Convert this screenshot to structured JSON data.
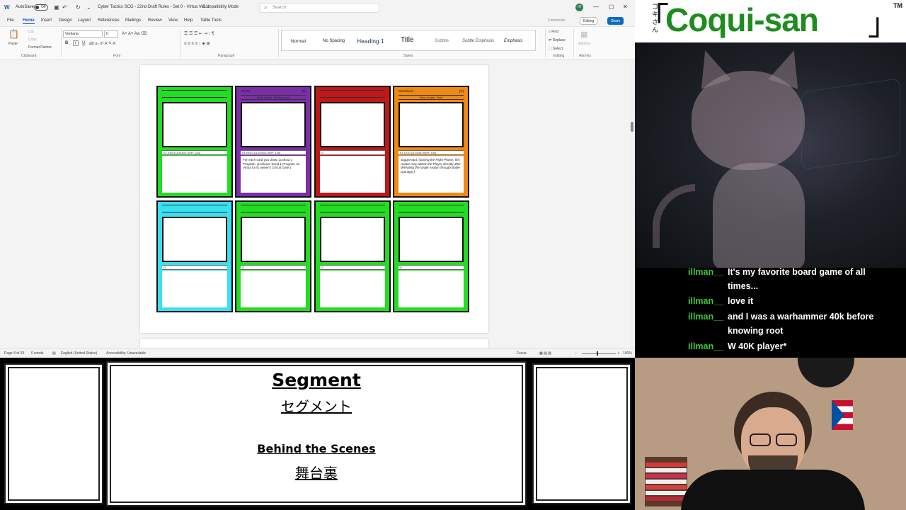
{
  "word": {
    "autosave_label": "AutoSave",
    "autosave_state": "Off",
    "doc_title": "Cyber Tactics SCG - 22nd Draft Rules - Set 0 - Virtua Vol. 1",
    "compat": "Compatibility Mode",
    "search_placeholder": "Search",
    "user_initials": "HI",
    "menus": [
      "File",
      "Home",
      "Insert",
      "Design",
      "Layout",
      "References",
      "Mailings",
      "Review",
      "View",
      "Help",
      "Table Tools"
    ],
    "comments_label": "Comments",
    "editing_label": "Editing",
    "share_label": "Share",
    "ribbon": {
      "paste": "Paste",
      "cut": "Cut",
      "copy": "Copy",
      "format_painter": "Format Painter",
      "font_name": "Verdana",
      "font_size": "6",
      "styles": [
        "Normal",
        "No Spacing",
        "Heading 1",
        "Title",
        "Subtitle",
        "Subtle Emphasis",
        "Emphasis"
      ],
      "find": "Find",
      "replace": "Replace",
      "select": "Select",
      "addin": "Add-ins",
      "groups": [
        "Clipboard",
        "Font",
        "Paragraph",
        "Styles",
        "Editing",
        "Add-ins"
      ]
    },
    "cards_row1": [
      {
        "color": "#22dd22",
        "name": "",
        "cost": "",
        "subtitle": "",
        "stat": "E1 EEE3     [A:60/02:30/H: 125]",
        "text": ""
      },
      {
        "color": "#7a2fa8",
        "name": "Yanika",
        "cost": "[E]",
        "subtitle": "Boss Avatar: Technomage",
        "stat": "E1 EEE3     [A:100/02:30/H: 125]",
        "text": "For each card you draw, Lockout 1 Program. (Lockout: Send 1 Program on Virtua to its owner's Circuit Gate.)"
      },
      {
        "color": "#c01818",
        "name": "",
        "cost": "",
        "subtitle": "",
        "stat": "G",
        "text": ""
      },
      {
        "color": "#ee8a11",
        "name": "Steeldozer",
        "cost": "[G]",
        "subtitle": "Boss Avatar: Tank",
        "stat": "E1 DGG     [A:150/D:53/H: 150]",
        "text": "Juggernaut. (During the Fight Phase, this Avatar may attack the Player directly after defeating the target Avatar through Battle Damage.)"
      }
    ],
    "cards_row2": [
      {
        "color": "#38e0f0",
        "stat": "G"
      },
      {
        "color": "#22dd22",
        "stat": "G"
      },
      {
        "color": "#22dd22",
        "stat": "G"
      },
      {
        "color": "#22dd22",
        "stat": "G"
      }
    ],
    "status": {
      "page": "Page 8 of 33",
      "words": "0 words",
      "lang": "English (United States)",
      "access": "Accessibility: Unavailable",
      "focus": "Focus",
      "zoom": "100%"
    }
  },
  "logo": {
    "kana": "コキさん",
    "name": "Coqui-san",
    "tm": "TM"
  },
  "chat": [
    {
      "user": "illman__",
      "text": "It's my favorite board game of all times..."
    },
    {
      "user": "illman__",
      "text": "love it"
    },
    {
      "user": "illman__",
      "text": "and I was a warhammer 40k before knowing root"
    },
    {
      "user": "illman__",
      "text": "W 40K player*"
    }
  ],
  "segment": {
    "title_en": "Segment",
    "title_jp": "セグメント",
    "sub_en": "Behind the Scenes",
    "sub_jp": "舞台裏"
  },
  "colors": {
    "logo_green": "#1f8c1f",
    "chat_user": "#3cc83c",
    "word_accent": "#185abd"
  }
}
